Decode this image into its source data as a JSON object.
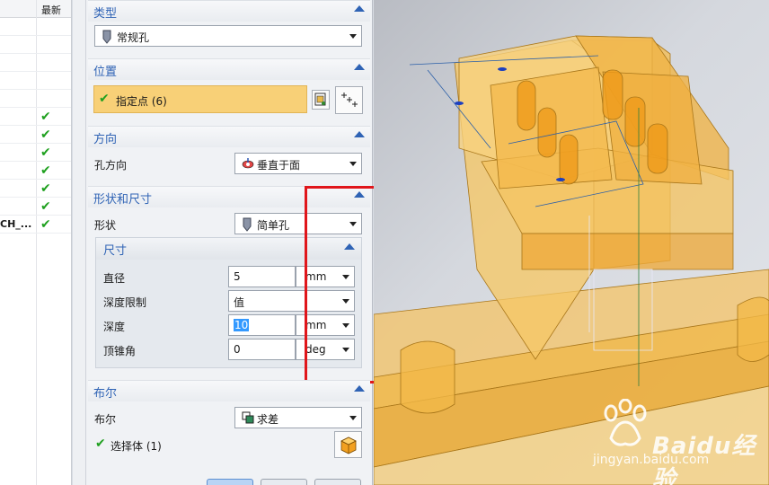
{
  "nav": {
    "header_label": "最新",
    "rows": [
      {
        "text": "",
        "checked": false
      },
      {
        "text": "",
        "checked": false
      },
      {
        "text": "",
        "checked": false
      },
      {
        "text": "",
        "checked": false
      },
      {
        "text": "",
        "checked": false
      },
      {
        "text": "",
        "checked": true
      },
      {
        "text": "",
        "checked": true
      },
      {
        "text": "",
        "checked": true
      },
      {
        "text": "",
        "checked": true
      },
      {
        "text": "",
        "checked": true
      },
      {
        "text": "",
        "checked": true
      },
      {
        "text": "CH_...",
        "checked": true
      }
    ],
    "check_glyph": "✔"
  },
  "dialog": {
    "type": {
      "title": "类型",
      "value": "常规孔",
      "icon": "hole-tool-icon"
    },
    "position": {
      "title": "位置",
      "value": "指定点 (6)",
      "check": "✔"
    },
    "direction": {
      "title": "方向",
      "label": "孔方向",
      "value": "垂直于面",
      "icon": "normal-direction-icon"
    },
    "shape": {
      "title": "形状和尺寸",
      "shape_label": "形状",
      "shape_value": "简单孔",
      "dimensions": {
        "title": "尺寸",
        "diameter_label": "直径",
        "diameter_value": "5",
        "diameter_unit": "mm",
        "depth_limit_label": "深度限制",
        "depth_limit_value": "值",
        "depth_label": "深度",
        "depth_value": "10",
        "depth_unit": "mm",
        "tip_angle_label": "顶锥角",
        "tip_angle_value": "0",
        "tip_angle_unit": "deg"
      }
    },
    "boolean": {
      "title": "布尔",
      "label": "布尔",
      "value": "求差",
      "select_body": "选择体 (1)",
      "check": "✔"
    }
  },
  "watermark": {
    "brand": "Baidu经验",
    "url": "jingyan.baidu.com"
  },
  "colors": {
    "accent": "#2f63b5",
    "highlight": "#f8d077",
    "annotation": "#e0161b",
    "model": "#f2b640"
  }
}
